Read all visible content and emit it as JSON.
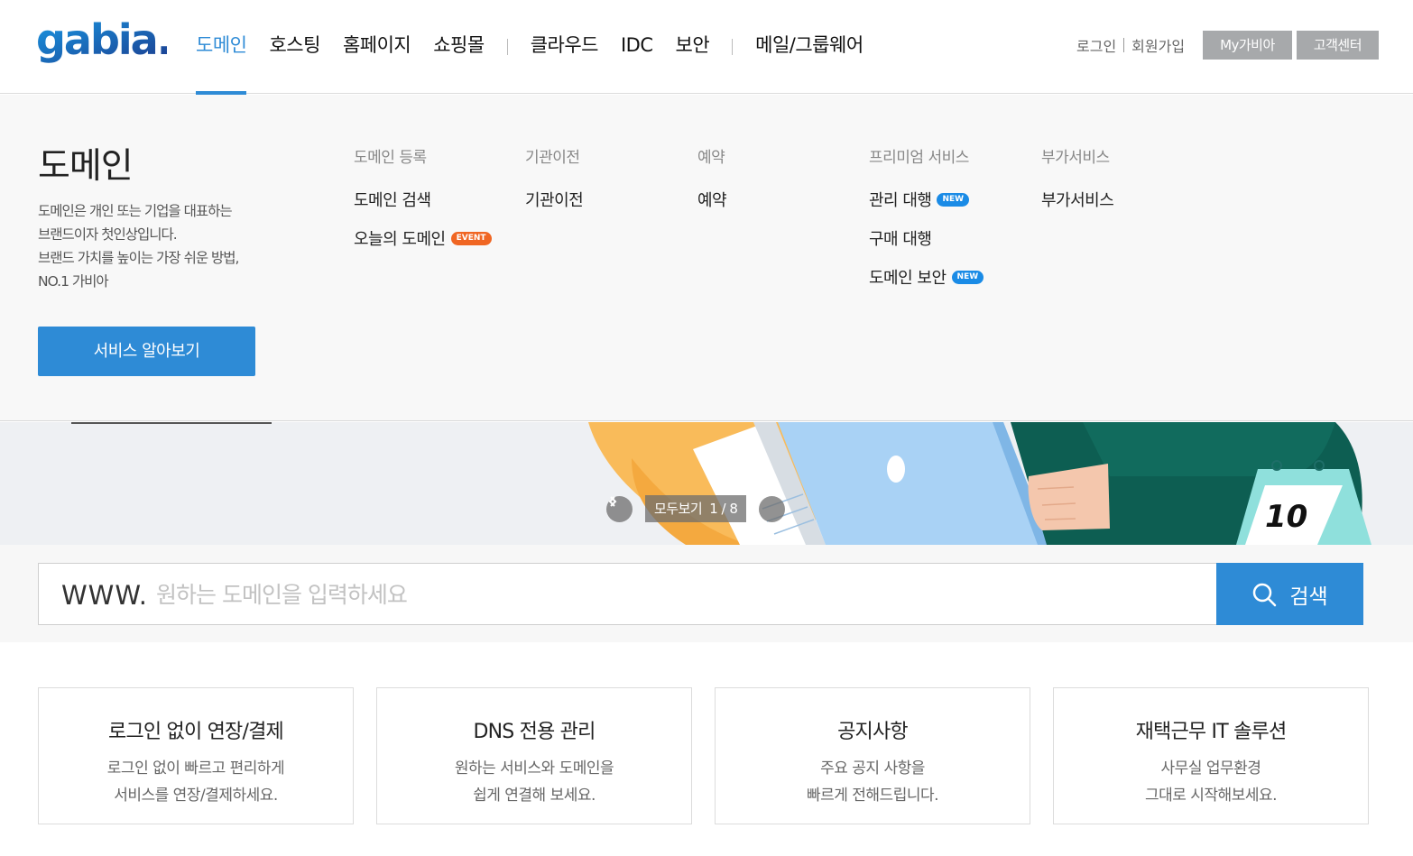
{
  "header": {
    "logo_text": "gabia.",
    "nav": [
      "도메인",
      "호스팅",
      "홈페이지",
      "쇼핑몰",
      "클라우드",
      "IDC",
      "보안",
      "메일/그룹웨어"
    ],
    "active_nav": "도메인",
    "util": {
      "login": "로그인",
      "signup": "회원가입",
      "mygabia": "My가비아",
      "support": "고객센터"
    }
  },
  "mega": {
    "title": "도메인",
    "desc": [
      "도메인은 개인 또는 기업을 대표하는",
      "브랜드이자 첫인상입니다.",
      "브랜드 가치를 높이는 가장 쉬운 방법,",
      "NO.1 가비아"
    ],
    "button": "서비스 알아보기",
    "columns": [
      {
        "head": "도메인 등록",
        "items": [
          {
            "label": "도메인 검색",
            "badge": ""
          },
          {
            "label": "오늘의 도메인",
            "badge": "EVENT"
          }
        ]
      },
      {
        "head": "기관이전",
        "items": [
          {
            "label": "기관이전",
            "badge": ""
          }
        ]
      },
      {
        "head": "예약",
        "items": [
          {
            "label": "예약",
            "badge": ""
          }
        ]
      },
      {
        "head": "프리미엄 서비스",
        "items": [
          {
            "label": "관리 대행",
            "badge": "NEW"
          },
          {
            "label": "구매 대행",
            "badge": ""
          },
          {
            "label": "도메인 보안",
            "badge": "NEW"
          }
        ]
      },
      {
        "head": "부가서비스",
        "items": [
          {
            "label": "부가서비스",
            "badge": ""
          }
        ]
      }
    ]
  },
  "banner": {
    "view_all": "모두보기",
    "page": "1 / 8",
    "calendar_day": "10"
  },
  "search": {
    "prefix": "WWW.",
    "placeholder": "원하는 도메인을 입력하세요",
    "button": "검색"
  },
  "cards": [
    {
      "title": "로그인 없이 연장/결제",
      "desc": [
        "로그인 없이 빠르고 편리하게",
        "서비스를 연장/결제하세요."
      ]
    },
    {
      "title": "DNS 전용 관리",
      "desc": [
        "원하는 서비스와 도메인을",
        "쉽게 연결해 보세요."
      ]
    },
    {
      "title": "공지사항",
      "desc": [
        "주요 공지 사항을",
        "빠르게 전해드립니다."
      ]
    },
    {
      "title": "재택근무 IT 솔루션",
      "desc": [
        "사무실 업무환경",
        "그대로 시작해보세요."
      ]
    }
  ],
  "colors": {
    "accent": "#2e8bd6",
    "util_button": "#a7a9ab",
    "badge_new": "#1a8be6",
    "badge_event": "#f06623"
  }
}
